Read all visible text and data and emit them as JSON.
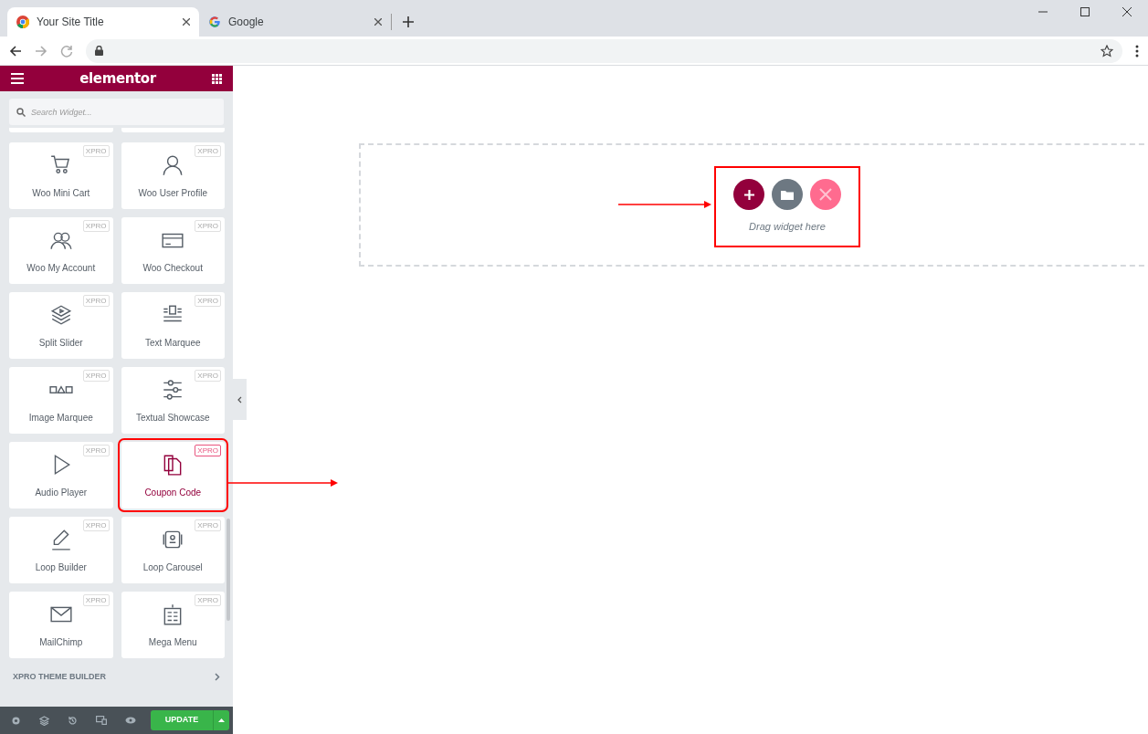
{
  "browser": {
    "tabs": [
      {
        "title": "Your Site Title",
        "selected": true,
        "kind": "chrome"
      },
      {
        "title": "Google",
        "selected": false,
        "kind": "google"
      }
    ]
  },
  "sidebar": {
    "logo": "elementor",
    "search": {
      "placeholder": "Search Widget..."
    },
    "widgets": [
      {
        "label": "Woo Mini Cart",
        "badge": "XPRO",
        "highlighted": false
      },
      {
        "label": "Woo User Profile",
        "badge": "XPRO",
        "highlighted": false
      },
      {
        "label": "Woo My Account",
        "badge": "XPRO",
        "highlighted": false
      },
      {
        "label": "Woo Checkout",
        "badge": "XPRO",
        "highlighted": false
      },
      {
        "label": "Split Slider",
        "badge": "XPRO",
        "highlighted": false
      },
      {
        "label": "Text Marquee",
        "badge": "XPRO",
        "highlighted": false
      },
      {
        "label": "Image Marquee",
        "badge": "XPRO",
        "highlighted": false
      },
      {
        "label": "Textual Showcase",
        "badge": "XPRO",
        "highlighted": false
      },
      {
        "label": "Audio Player",
        "badge": "XPRO",
        "highlighted": false
      },
      {
        "label": "Coupon Code",
        "badge": "XPRO",
        "highlighted": true
      },
      {
        "label": "Loop Builder",
        "badge": "XPRO",
        "highlighted": false
      },
      {
        "label": "Loop Carousel",
        "badge": "XPRO",
        "highlighted": false
      },
      {
        "label": "MailChimp",
        "badge": "XPRO",
        "highlighted": false
      },
      {
        "label": "Mega Menu",
        "badge": "XPRO",
        "highlighted": false
      }
    ],
    "section": "XPRO THEME BUILDER",
    "update_button": "UPDATE"
  },
  "canvas": {
    "drop_hint": "Drag widget here"
  }
}
